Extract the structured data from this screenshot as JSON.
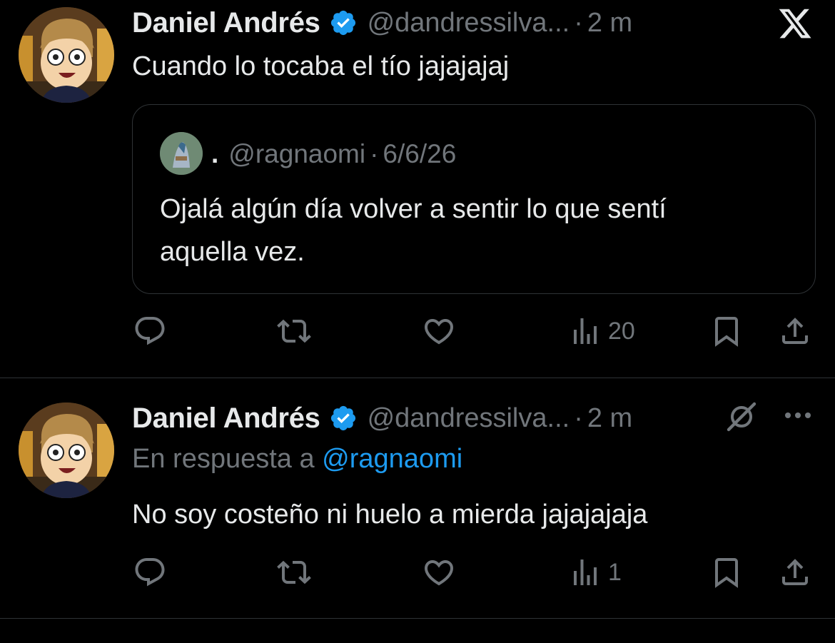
{
  "tweets": [
    {
      "author_name": "Daniel Andrés",
      "handle": "@dandressilva...",
      "separator": "·",
      "time": "2 m",
      "text": "Cuando lo tocaba el tío jajajajaj",
      "quoted": {
        "author_name": ".",
        "handle": "@ragnaomi",
        "separator": "·",
        "date": "6/6/26",
        "text_line1": "Ojalá algún día volver a sentir lo que sentí",
        "text_line2": "aquella vez."
      },
      "views": "20"
    },
    {
      "author_name": "Daniel Andrés",
      "handle": "@dandressilva...",
      "separator": "·",
      "time": "2 m",
      "reply_prefix": "En respuesta a ",
      "reply_mention": "@ragnaomi",
      "text": "No soy costeño ni huelo a mierda jajajajaja",
      "views": "1"
    }
  ],
  "icons": {
    "close": "x-logo-icon",
    "verified": "verified-badge-icon",
    "reply": "reply-icon",
    "retweet": "retweet-icon",
    "like": "heart-icon",
    "views": "views-icon",
    "bookmark": "bookmark-icon",
    "share": "share-icon",
    "grok": "grok-icon",
    "more": "more-icon"
  },
  "colors": {
    "background": "#000000",
    "text": "#e7e9ea",
    "muted": "#71767b",
    "accent": "#1d9bf0",
    "border": "#2f3336"
  }
}
